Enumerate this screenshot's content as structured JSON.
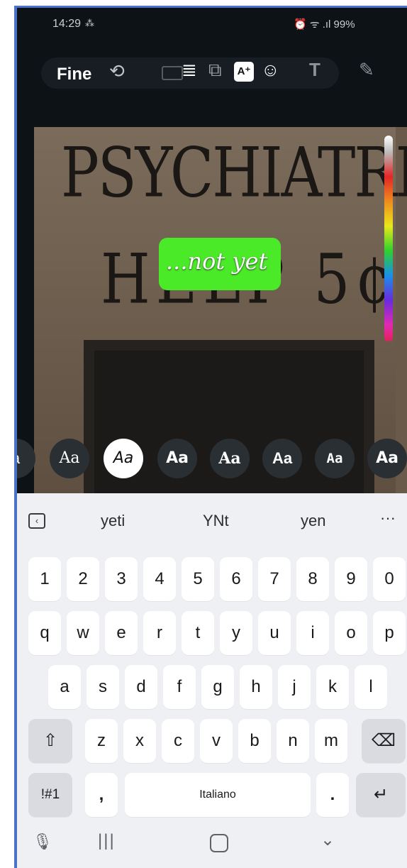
{
  "status": {
    "time": "14:29",
    "extra": "⁂",
    "right": "⏰ ᯤ .ıl 99%"
  },
  "toolbar": {
    "done_label": "Fine"
  },
  "canvas": {
    "sign_line1": "PSYCHIATRIC",
    "sign_line2": "HELP 5¢",
    "sticker_text": "...not yet"
  },
  "fonts": [
    "a",
    "Aa",
    "Aa",
    "Aa",
    "Aa",
    "Aa",
    "Aa",
    "Aa"
  ],
  "keyboard": {
    "suggestions": [
      "yeti",
      "YNt",
      "yen"
    ],
    "more": "···",
    "row_numbers": [
      "1",
      "2",
      "3",
      "4",
      "5",
      "6",
      "7",
      "8",
      "9",
      "0"
    ],
    "row1": [
      "q",
      "w",
      "e",
      "r",
      "t",
      "y",
      "u",
      "i",
      "o",
      "p"
    ],
    "row2": [
      "a",
      "s",
      "d",
      "f",
      "g",
      "h",
      "j",
      "k",
      "l"
    ],
    "row3": [
      "z",
      "x",
      "c",
      "v",
      "b",
      "n",
      "m"
    ],
    "sym_label": "!#1",
    "comma": ",",
    "space_label": "Italiano",
    "period": "."
  },
  "colors": {
    "accent_border": "#4a72c6",
    "sticker_bg": "#4bea28"
  }
}
